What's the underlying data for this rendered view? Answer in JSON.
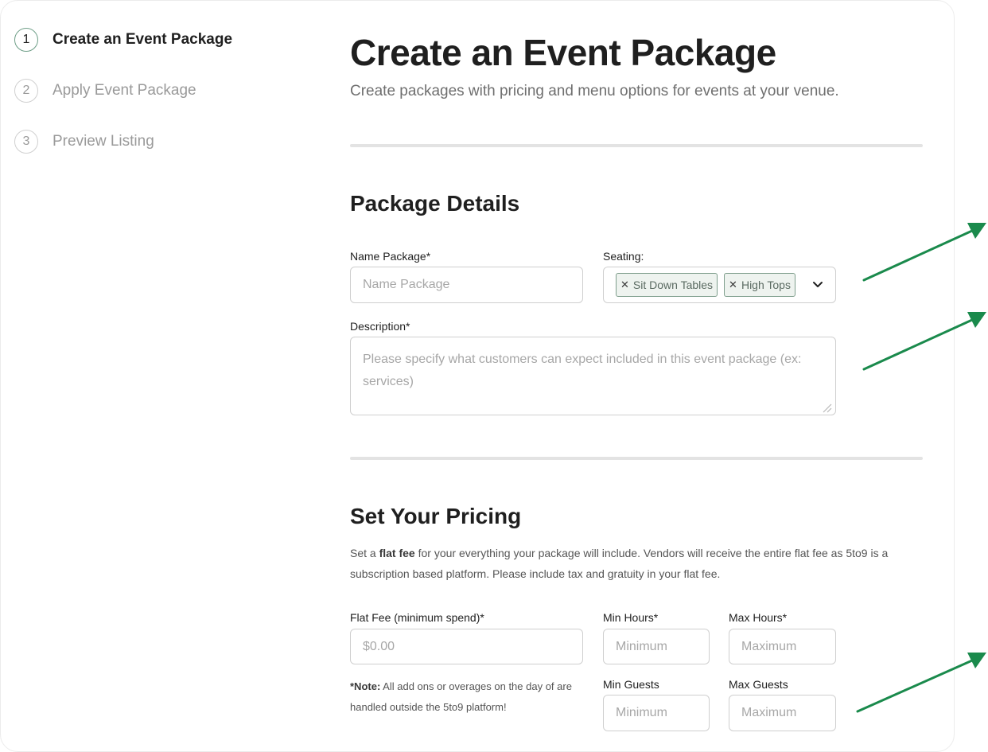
{
  "steps": [
    {
      "num": "1",
      "label": "Create an Event Package",
      "active": true
    },
    {
      "num": "2",
      "label": "Apply Event Package",
      "active": false
    },
    {
      "num": "3",
      "label": "Preview Listing",
      "active": false
    }
  ],
  "header": {
    "title": "Create an Event Package",
    "subtitle": "Create packages with pricing and menu options for events at your venue."
  },
  "package_details": {
    "title": "Package Details",
    "name_label": "Name Package*",
    "name_placeholder": "Name Package",
    "seating_label": "Seating:",
    "seating_chips": [
      "Sit Down Tables",
      "High Tops"
    ],
    "description_label": "Description*",
    "description_placeholder": "Please specify what customers can expect included in this event package (ex: services)"
  },
  "pricing": {
    "title": "Set Your Pricing",
    "desc_before": "Set a ",
    "desc_bold": "flat fee",
    "desc_after": " for your everything your package will include. Vendors will receive the entire flat fee as 5to9 is a subscription based platform. Please include tax and gratuity in your flat fee.",
    "flat_fee_label": "Flat Fee (minimum spend)*",
    "flat_fee_placeholder": "$0.00",
    "min_hours_label": "Min Hours*",
    "min_hours_placeholder": "Minimum",
    "max_hours_label": "Max Hours*",
    "max_hours_placeholder": "Maximum",
    "min_guests_label": "Min Guests",
    "min_guests_placeholder": "Minimum",
    "max_guests_label": "Max Guests",
    "max_guests_placeholder": "Maximum",
    "note_bold": "*Note:",
    "note_text": " All add ons or overages on the day of are handled outside the 5to9 platform!"
  },
  "colors": {
    "arrow": "#1a8a4c",
    "chip_border": "#7e9e8c",
    "active_step_ring": "#6e9e87"
  }
}
